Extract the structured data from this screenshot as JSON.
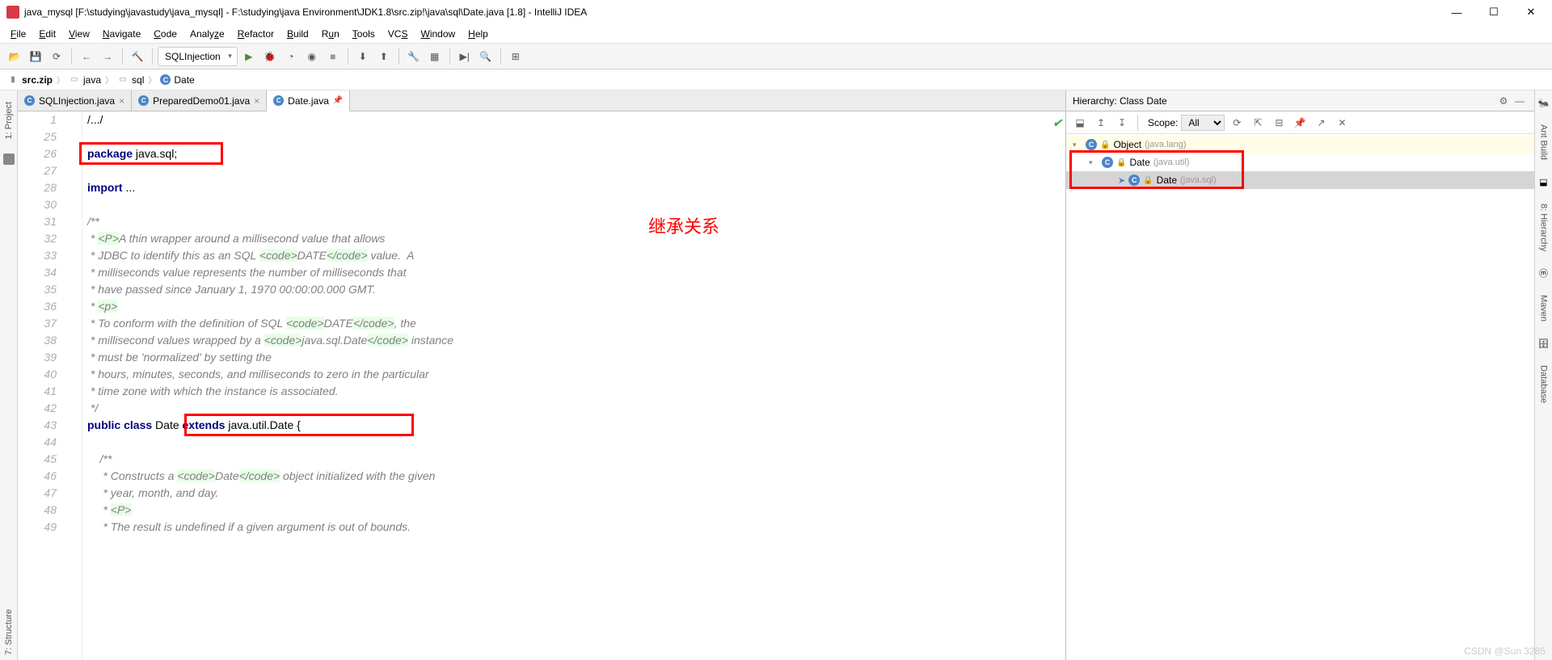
{
  "window": {
    "title": "java_mysql [F:\\studying\\javastudy\\java_mysql] - F:\\studying\\java Environment\\JDK1.8\\src.zip!\\java\\sql\\Date.java [1.8] - IntelliJ IDEA"
  },
  "menu": [
    "File",
    "Edit",
    "View",
    "Navigate",
    "Code",
    "Analyze",
    "Refactor",
    "Build",
    "Run",
    "Tools",
    "VCS",
    "Window",
    "Help"
  ],
  "runconfig": "SQLInjection",
  "breadcrumb": [
    {
      "icon": "zip",
      "label": "src.zip"
    },
    {
      "icon": "pkg",
      "label": "java"
    },
    {
      "icon": "pkg",
      "label": "sql"
    },
    {
      "icon": "cls",
      "label": "Date"
    }
  ],
  "tabs": [
    {
      "label": "SQLInjection.java",
      "active": false
    },
    {
      "label": "PreparedDemo01.java",
      "active": false
    },
    {
      "label": "Date.java",
      "active": true
    }
  ],
  "code": {
    "lines": [
      {
        "n": 1,
        "html": "<span class='plain'>/.../</span>"
      },
      {
        "n": 25,
        "html": ""
      },
      {
        "n": 26,
        "html": "<span class='kw'>package</span><span class='plain'> java.sql;</span>"
      },
      {
        "n": 27,
        "html": ""
      },
      {
        "n": 28,
        "html": "<span class='kw'>import</span><span class='plain'> ...</span>"
      },
      {
        "n": 30,
        "html": ""
      },
      {
        "n": 31,
        "html": "/**"
      },
      {
        "n": 32,
        "html": " * <span class='tag'>&lt;P&gt;</span>A thin wrapper around a millisecond value that allows"
      },
      {
        "n": 33,
        "html": " * JDBC to identify this as an SQL <span class='tag'>&lt;code&gt;</span>DATE<span class='tag'>&lt;/code&gt;</span> value.  A"
      },
      {
        "n": 34,
        "html": " * milliseconds value represents the number of milliseconds that"
      },
      {
        "n": 35,
        "html": " * have passed since January 1, 1970 00:00:00.000 GMT."
      },
      {
        "n": 36,
        "html": " * <span class='tag'>&lt;p&gt;</span>"
      },
      {
        "n": 37,
        "html": " * To conform with the definition of SQL <span class='tag'>&lt;code&gt;</span>DATE<span class='tag'>&lt;/code&gt;</span>, the"
      },
      {
        "n": 38,
        "html": " * millisecond values wrapped by a <span class='tag'>&lt;code&gt;</span>java.sql.Date<span class='tag'>&lt;/code&gt;</span> instance"
      },
      {
        "n": 39,
        "html": " * must be 'normalized' by setting the"
      },
      {
        "n": 40,
        "html": " * hours, minutes, seconds, and milliseconds to zero in the particular"
      },
      {
        "n": 41,
        "html": " * time zone with which the instance is associated."
      },
      {
        "n": 42,
        "html": " */"
      },
      {
        "n": 43,
        "html": "<span class='kw'>public class</span><span class='plain'> Date </span><span class='kw'>extends</span><span class='plain'> java.util.Date {</span>"
      },
      {
        "n": 44,
        "html": ""
      },
      {
        "n": 45,
        "html": "    /**"
      },
      {
        "n": 46,
        "html": "     * Constructs a <span class='tag'>&lt;code&gt;</span>Date<span class='tag'>&lt;/code&gt;</span> object initialized with the given"
      },
      {
        "n": 47,
        "html": "     * year, month, and day."
      },
      {
        "n": 48,
        "html": "     * <span class='tag'>&lt;P&gt;</span>"
      },
      {
        "n": 49,
        "html": "     * The result is undefined if a given argument is out of bounds."
      }
    ]
  },
  "annotation_text": "继承关系",
  "hierarchy": {
    "title": "Hierarchy:  Class Date",
    "scope_label": "Scope:",
    "scope_value": "All",
    "tree": [
      {
        "indent": 0,
        "name": "Object",
        "pkg": "(java.lang)",
        "hl": true
      },
      {
        "indent": 1,
        "name": "Date",
        "pkg": "(java.util)",
        "hl": false
      },
      {
        "indent": 2,
        "name": "Date",
        "pkg": "(java.sql)",
        "sel": true
      }
    ]
  },
  "leftrail": [
    "1: Project",
    "7: Structure"
  ],
  "rightrail": [
    "Ant Build",
    "8: Hierarchy",
    "Maven",
    "Database"
  ],
  "watermark": "CSDN @Sun 3285"
}
